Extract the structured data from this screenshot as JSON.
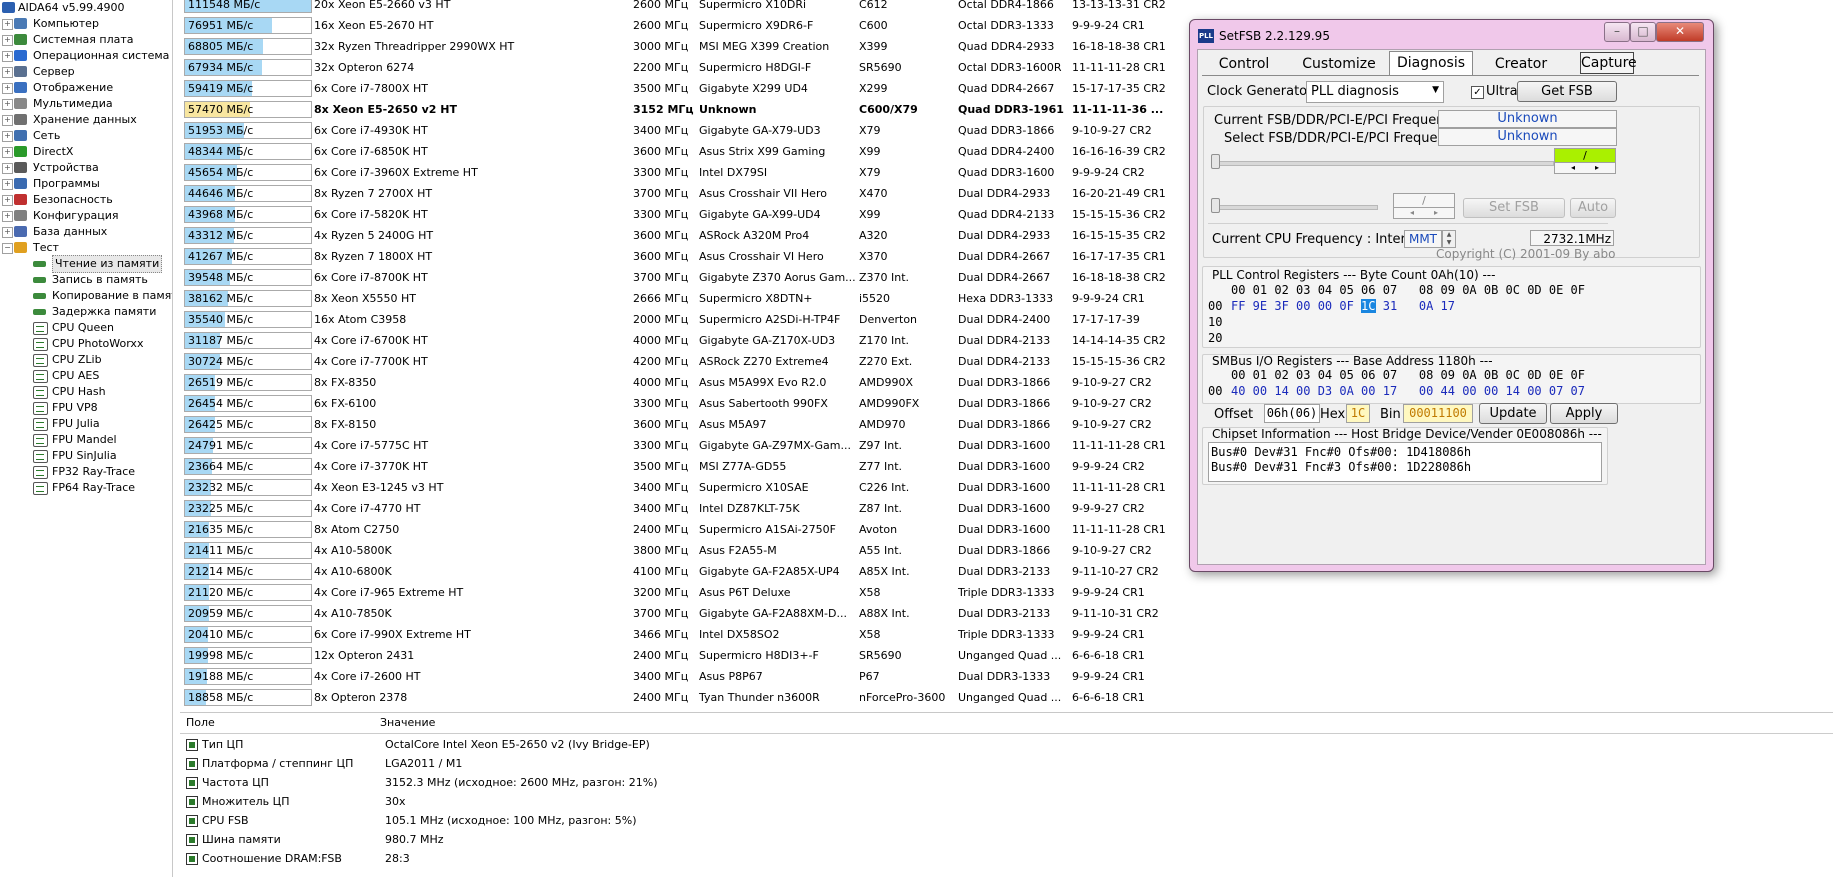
{
  "tree": {
    "items": [
      {
        "label": "AIDA64 v5.99.4900",
        "color": "#2b5fb0"
      },
      {
        "label": "Компьютер",
        "color": "#4a7ab5"
      },
      {
        "label": "Системная плата",
        "color": "#3c8a3c"
      },
      {
        "label": "Операционная система",
        "color": "#2a6ad0"
      },
      {
        "label": "Сервер",
        "color": "#5a7090"
      },
      {
        "label": "Отображение",
        "color": "#3a70c0"
      },
      {
        "label": "Мультимедиа",
        "color": "#888888"
      },
      {
        "label": "Хранение данных",
        "color": "#707070"
      },
      {
        "label": "Сеть",
        "color": "#4070b0"
      },
      {
        "label": "DirectX",
        "color": "#2a9a2a"
      },
      {
        "label": "Устройства",
        "color": "#5a5a5a"
      },
      {
        "label": "Программы",
        "color": "#3a6ab0"
      },
      {
        "label": "Безопасность",
        "color": "#c03030"
      },
      {
        "label": "Конфигурация",
        "color": "#808080"
      },
      {
        "label": "База данных",
        "color": "#4a6ab0"
      },
      {
        "label": "Тест",
        "color": "#e0a020"
      }
    ],
    "test_items": [
      "Чтение из памяти",
      "Запись в память",
      "Копирование в памят",
      "Задержка памяти",
      "CPU Queen",
      "CPU PhotoWorxx",
      "CPU ZLib",
      "CPU AES",
      "CPU Hash",
      "FPU VP8",
      "FPU Julia",
      "FPU Mandel",
      "FPU SinJulia",
      "FP32 Ray-Trace",
      "FP64 Ray-Trace"
    ]
  },
  "results": {
    "max_value": 111548,
    "rows": [
      {
        "value": 111548,
        "label": "111548 МБ/с",
        "cpu": "20x Xeon E5-2660 v3 HT",
        "freq": "2600 МГц",
        "board": "Supermicro X10DRi",
        "chipset": "C612",
        "mem": "Octal DDR4-1866",
        "timing": "13-13-13-31 CR2"
      },
      {
        "value": 76951,
        "label": "76951 МБ/с",
        "cpu": "16x Xeon E5-2670 HT",
        "freq": "2600 МГц",
        "board": "Supermicro X9DR6-F",
        "chipset": "C600",
        "mem": "Octal DDR3-1333",
        "timing": "9-9-9-24 CR1"
      },
      {
        "value": 68805,
        "label": "68805 МБ/с",
        "cpu": "32x Ryzen Threadripper 2990WX HT",
        "freq": "3000 МГц",
        "board": "MSI MEG X399 Creation",
        "chipset": "X399",
        "mem": "Quad DDR4-2933",
        "timing": "16-18-18-38 CR1"
      },
      {
        "value": 67934,
        "label": "67934 МБ/с",
        "cpu": "32x Opteron 6274",
        "freq": "2200 МГц",
        "board": "Supermicro H8DGI-F",
        "chipset": "SR5690",
        "mem": "Octal DDR3-1600R",
        "timing": "11-11-11-28 CR1"
      },
      {
        "value": 59419,
        "label": "59419 МБ/с",
        "cpu": "6x Core i7-7800X HT",
        "freq": "3500 МГц",
        "board": "Gigabyte X299 UD4",
        "chipset": "X299",
        "mem": "Quad DDR4-2667",
        "timing": "15-17-17-35 CR2"
      },
      {
        "value": 57470,
        "label": "57470 МБ/с",
        "cpu": "8x Xeon E5-2650 v2 HT",
        "freq": "3152 МГц",
        "board": "Unknown",
        "chipset": "C600/X79",
        "mem": "Quad DDR3-1961",
        "timing": "11-11-11-36 ...",
        "highlight": true
      },
      {
        "value": 51953,
        "label": "51953 МБ/с",
        "cpu": "6x Core i7-4930K HT",
        "freq": "3400 МГц",
        "board": "Gigabyte GA-X79-UD3",
        "chipset": "X79",
        "mem": "Quad DDR3-1866",
        "timing": "9-10-9-27 CR2"
      },
      {
        "value": 48344,
        "label": "48344 МБ/с",
        "cpu": "6x Core i7-6850K HT",
        "freq": "3600 МГц",
        "board": "Asus Strix X99 Gaming",
        "chipset": "X99",
        "mem": "Quad DDR4-2400",
        "timing": "16-16-16-39 CR2"
      },
      {
        "value": 45654,
        "label": "45654 МБ/с",
        "cpu": "6x Core i7-3960X Extreme HT",
        "freq": "3300 МГц",
        "board": "Intel DX79SI",
        "chipset": "X79",
        "mem": "Quad DDR3-1600",
        "timing": "9-9-9-24 CR2"
      },
      {
        "value": 44646,
        "label": "44646 МБ/с",
        "cpu": "8x Ryzen 7 2700X HT",
        "freq": "3700 МГц",
        "board": "Asus Crosshair VII Hero",
        "chipset": "X470",
        "mem": "Dual DDR4-2933",
        "timing": "16-20-21-49 CR1"
      },
      {
        "value": 43968,
        "label": "43968 МБ/с",
        "cpu": "6x Core i7-5820K HT",
        "freq": "3300 МГц",
        "board": "Gigabyte GA-X99-UD4",
        "chipset": "X99",
        "mem": "Quad DDR4-2133",
        "timing": "15-15-15-36 CR2"
      },
      {
        "value": 43312,
        "label": "43312 МБ/с",
        "cpu": "4x Ryzen 5 2400G HT",
        "freq": "3600 МГц",
        "board": "ASRock A320M Pro4",
        "chipset": "A320",
        "mem": "Dual DDR4-2933",
        "timing": "16-15-15-35 CR2"
      },
      {
        "value": 41267,
        "label": "41267 МБ/с",
        "cpu": "8x Ryzen 7 1800X HT",
        "freq": "3600 МГц",
        "board": "Asus Crosshair VI Hero",
        "chipset": "X370",
        "mem": "Dual DDR4-2667",
        "timing": "16-17-17-35 CR1"
      },
      {
        "value": 39548,
        "label": "39548 МБ/с",
        "cpu": "6x Core i7-8700K HT",
        "freq": "3700 МГц",
        "board": "Gigabyte Z370 Aorus Gam...",
        "chipset": "Z370 Int.",
        "mem": "Dual DDR4-2667",
        "timing": "16-18-18-38 CR2"
      },
      {
        "value": 38162,
        "label": "38162 МБ/с",
        "cpu": "8x Xeon X5550 HT",
        "freq": "2666 МГц",
        "board": "Supermicro X8DTN+",
        "chipset": "i5520",
        "mem": "Hexa DDR3-1333",
        "timing": "9-9-9-24 CR1"
      },
      {
        "value": 35540,
        "label": "35540 МБ/с",
        "cpu": "16x Atom C3958",
        "freq": "2000 МГц",
        "board": "Supermicro A2SDi-H-TP4F",
        "chipset": "Denverton",
        "mem": "Dual DDR4-2400",
        "timing": "17-17-17-39"
      },
      {
        "value": 31187,
        "label": "31187 МБ/с",
        "cpu": "4x Core i7-6700K HT",
        "freq": "4000 МГц",
        "board": "Gigabyte GA-Z170X-UD3",
        "chipset": "Z170 Int.",
        "mem": "Dual DDR4-2133",
        "timing": "14-14-14-35 CR2"
      },
      {
        "value": 30724,
        "label": "30724 МБ/с",
        "cpu": "4x Core i7-7700K HT",
        "freq": "4200 МГц",
        "board": "ASRock Z270 Extreme4",
        "chipset": "Z270 Ext.",
        "mem": "Dual DDR4-2133",
        "timing": "15-15-15-36 CR2"
      },
      {
        "value": 26519,
        "label": "26519 МБ/с",
        "cpu": "8x FX-8350",
        "freq": "4000 МГц",
        "board": "Asus M5A99X Evo R2.0",
        "chipset": "AMD990X",
        "mem": "Dual DDR3-1866",
        "timing": "9-10-9-27 CR2"
      },
      {
        "value": 26454,
        "label": "26454 МБ/с",
        "cpu": "6x FX-6100",
        "freq": "3300 МГц",
        "board": "Asus Sabertooth 990FX",
        "chipset": "AMD990FX",
        "mem": "Dual DDR3-1866",
        "timing": "9-10-9-27 CR2"
      },
      {
        "value": 26425,
        "label": "26425 МБ/с",
        "cpu": "8x FX-8150",
        "freq": "3600 МГц",
        "board": "Asus M5A97",
        "chipset": "AMD970",
        "mem": "Dual DDR3-1866",
        "timing": "9-10-9-27 CR2"
      },
      {
        "value": 24791,
        "label": "24791 МБ/с",
        "cpu": "4x Core i7-5775C HT",
        "freq": "3300 МГц",
        "board": "Gigabyte GA-Z97MX-Gam...",
        "chipset": "Z97 Int.",
        "mem": "Dual DDR3-1600",
        "timing": "11-11-11-28 CR1"
      },
      {
        "value": 23664,
        "label": "23664 МБ/с",
        "cpu": "4x Core i7-3770K HT",
        "freq": "3500 МГц",
        "board": "MSI Z77A-GD55",
        "chipset": "Z77 Int.",
        "mem": "Dual DDR3-1600",
        "timing": "9-9-9-24 CR2"
      },
      {
        "value": 23232,
        "label": "23232 МБ/с",
        "cpu": "4x Xeon E3-1245 v3 HT",
        "freq": "3400 МГц",
        "board": "Supermicro X10SAE",
        "chipset": "C226 Int.",
        "mem": "Dual DDR3-1600",
        "timing": "11-11-11-28 CR1"
      },
      {
        "value": 23225,
        "label": "23225 МБ/с",
        "cpu": "4x Core i7-4770 HT",
        "freq": "3400 МГц",
        "board": "Intel DZ87KLT-75K",
        "chipset": "Z87 Int.",
        "mem": "Dual DDR3-1600",
        "timing": "9-9-9-27 CR2"
      },
      {
        "value": 21635,
        "label": "21635 МБ/с",
        "cpu": "8x Atom C2750",
        "freq": "2400 МГц",
        "board": "Supermicro A1SAi-2750F",
        "chipset": "Avoton",
        "mem": "Dual DDR3-1600",
        "timing": "11-11-11-28 CR1"
      },
      {
        "value": 21411,
        "label": "21411 МБ/с",
        "cpu": "4x A10-5800K",
        "freq": "3800 МГц",
        "board": "Asus F2A55-M",
        "chipset": "A55 Int.",
        "mem": "Dual DDR3-1866",
        "timing": "9-10-9-27 CR2"
      },
      {
        "value": 21214,
        "label": "21214 МБ/с",
        "cpu": "4x A10-6800K",
        "freq": "4100 МГц",
        "board": "Gigabyte GA-F2A85X-UP4",
        "chipset": "A85X Int.",
        "mem": "Dual DDR3-2133",
        "timing": "9-11-10-27 CR2"
      },
      {
        "value": 21120,
        "label": "21120 МБ/с",
        "cpu": "4x Core i7-965 Extreme HT",
        "freq": "3200 МГц",
        "board": "Asus P6T Deluxe",
        "chipset": "X58",
        "mem": "Triple DDR3-1333",
        "timing": "9-9-9-24 CR1"
      },
      {
        "value": 20959,
        "label": "20959 МБ/с",
        "cpu": "4x A10-7850K",
        "freq": "3700 МГц",
        "board": "Gigabyte GA-F2A88XM-D...",
        "chipset": "A88X Int.",
        "mem": "Dual DDR3-2133",
        "timing": "9-11-10-31 CR2"
      },
      {
        "value": 20410,
        "label": "20410 МБ/с",
        "cpu": "6x Core i7-990X Extreme HT",
        "freq": "3466 МГц",
        "board": "Intel DX58SO2",
        "chipset": "X58",
        "mem": "Triple DDR3-1333",
        "timing": "9-9-9-24 CR1"
      },
      {
        "value": 19998,
        "label": "19998 МБ/с",
        "cpu": "12x Opteron 2431",
        "freq": "2400 МГц",
        "board": "Supermicro H8DI3+-F",
        "chipset": "SR5690",
        "mem": "Unganged Quad ...",
        "timing": "6-6-6-18 CR1"
      },
      {
        "value": 19188,
        "label": "19188 МБ/с",
        "cpu": "4x Core i7-2600 HT",
        "freq": "3400 МГц",
        "board": "Asus P8P67",
        "chipset": "P67",
        "mem": "Dual DDR3-1333",
        "timing": "9-9-9-24 CR1"
      },
      {
        "value": 18858,
        "label": "18858 МБ/с",
        "cpu": "8x Opteron 2378",
        "freq": "2400 МГц",
        "board": "Tyan Thunder n3600R",
        "chipset": "nForcePro-3600",
        "mem": "Unganged Quad ...",
        "timing": "6-6-6-18 CR1"
      }
    ]
  },
  "details": {
    "header_field": "Поле",
    "header_value": "Значение",
    "rows": [
      {
        "field": "Тип ЦП",
        "value": "OctalCore Intel Xeon E5-2650 v2  (Ivy Bridge-EP)"
      },
      {
        "field": "Платформа / степпинг ЦП",
        "value": "LGA2011 / M1"
      },
      {
        "field": "Частота ЦП",
        "value": "3152.3 MHz  (исходное: 2600 MHz, разгон: 21%)"
      },
      {
        "field": "Множитель ЦП",
        "value": "30x"
      },
      {
        "field": "CPU FSB",
        "value": "105.1 MHz  (исходное: 100 MHz, разгон: 5%)"
      },
      {
        "field": "Шина памяти",
        "value": "980.7 MHz"
      },
      {
        "field": "Соотношение DRAM:FSB",
        "value": "28:3"
      }
    ]
  },
  "setfsb": {
    "title": "SetFSB 2.2.129.95",
    "icon_text": "PLL",
    "tabs": [
      "Control",
      "Customize",
      "Diagnosis",
      "Creator"
    ],
    "capture_label": "Capture",
    "clock_generator_label": "Clock Generator",
    "clock_generator_value": "PLL diagnosis",
    "ultra_label": "Ultra",
    "get_fsb_label": "Get FSB",
    "current_freq_label": "Current FSB/DDR/PCI-E/PCI Frequency",
    "current_freq_value": "Unknown",
    "select_freq_label": "Select FSB/DDR/PCI-E/PCI Frequency",
    "select_freq_value": "Unknown",
    "slash1": "/",
    "slash2": "/",
    "set_fsb_label": "Set FSB",
    "auto_label": "Auto",
    "cpu_freq_label": "Current CPU Frequency : Internal",
    "mmt_label": "MMT",
    "cpu_freq_value": "2732.1MHz",
    "copyright": "Copyright (C) 2001-09 By abo",
    "pll_header": "PLL Control Registers  --- Byte Count 0Ah(10) ---",
    "pll_cols": "00 01 02 03 04 05 06 07   08 09 0A 0B 0C 0D 0E 0F",
    "pll_row0_addr": "00",
    "pll_row0_a": "FF 9E 3F 00 00 0F ",
    "pll_row0_sel": "1C",
    "pll_row0_b": " 31   0A 17",
    "pll_row1_addr": "10",
    "pll_row2_addr": "20",
    "smbus_header": "SMBus I/O Registers  --- Base Address 1180h ---",
    "smbus_cols": "00 01 02 03 04 05 06 07   08 09 0A 0B 0C 0D 0E 0F",
    "smbus_row0_addr": "00",
    "smbus_row0": "40 00 14 00 D3 0A 00 17   00 44 00 00 14 00 07 07",
    "offset_label": "Offset",
    "offset_value": "06h(06)",
    "hex_label": "Hex",
    "hex_value": "1C",
    "bin_label": "Bin",
    "bin_value": "00011100",
    "update_label": "Update",
    "apply_label": "Apply",
    "chipset_header": "Chipset Information  --- Host Bridge Device/Vender 0E008086h ---",
    "chipset_line1": "Bus#0 Dev#31 Fnc#0 Ofs#00: 1D418086h",
    "chipset_line2": "Bus#0 Dev#31 Fnc#3 Ofs#00: 1D228086h",
    "accent_green": "#aaf000"
  }
}
